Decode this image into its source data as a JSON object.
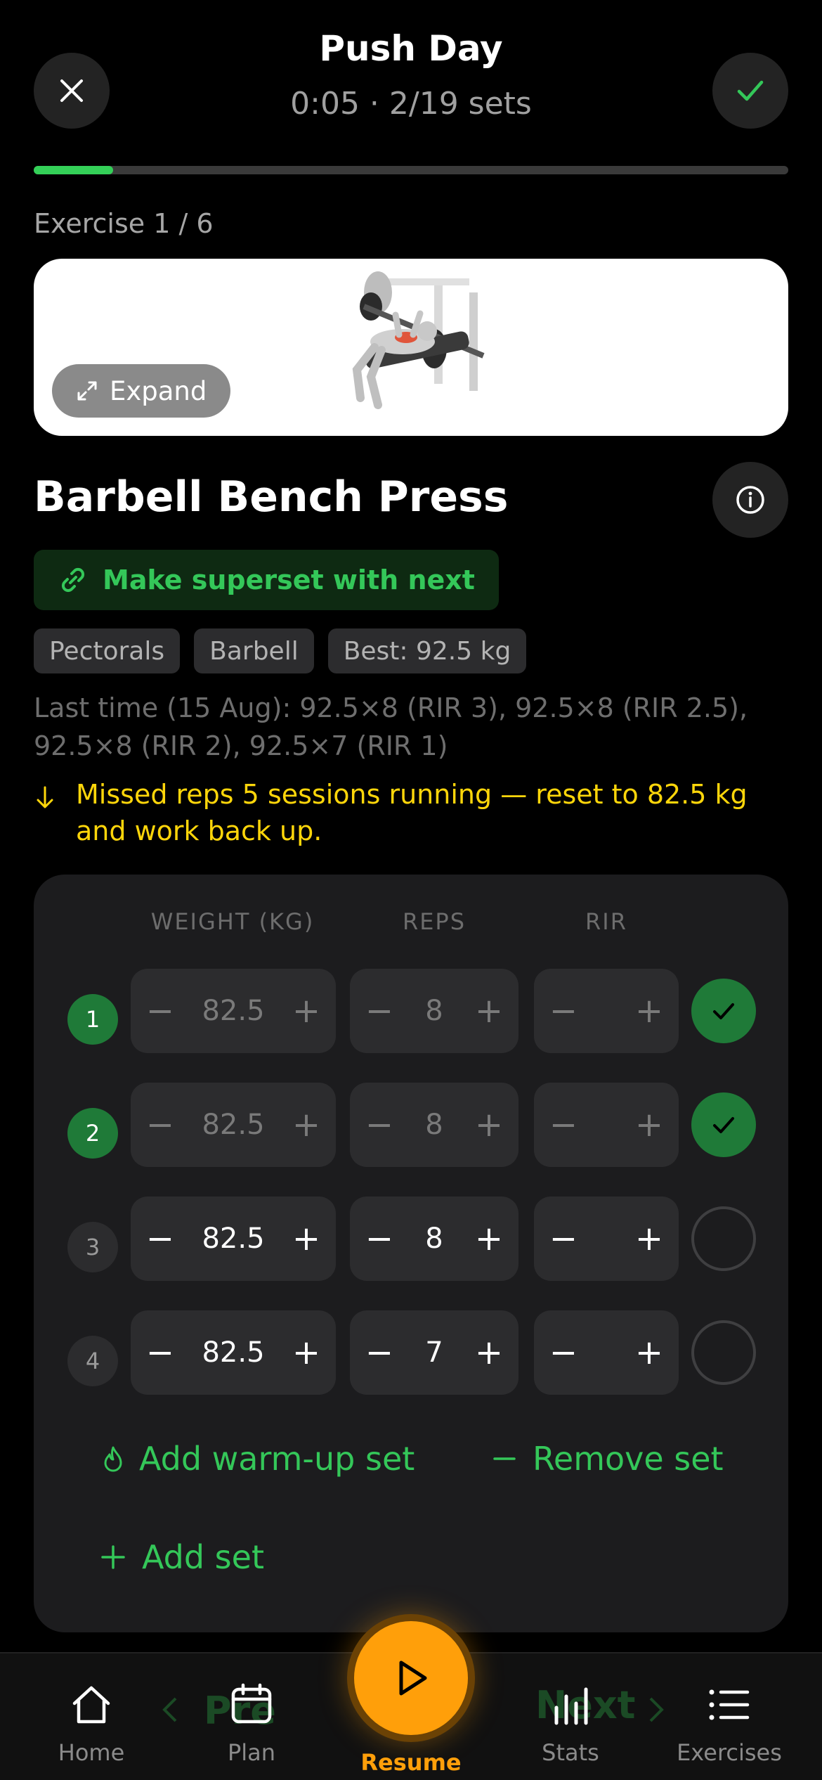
{
  "header": {
    "title": "Push Day",
    "subtitle": "0:05 · 2/19 sets",
    "progress_fraction": 0.1053
  },
  "exercise": {
    "counter": "Exercise 1 / 6",
    "expand_label": "Expand",
    "name": "Barbell Bench Press",
    "superset_label": "Make superset with next",
    "tags": [
      "Pectorals",
      "Barbell",
      "Best: 92.5 kg"
    ],
    "last_time": "Last time (15 Aug): 92.5×8 (RIR 3), 92.5×8 (RIR 2.5), 92.5×8 (RIR 2), 92.5×7 (RIR 1)",
    "warning": "Missed reps 5 sessions running — reset to 82.5 kg and work back up."
  },
  "sets_table": {
    "headers": {
      "weight": "WEIGHT (KG)",
      "reps": "REPS",
      "rir": "RIR"
    },
    "minus": "−",
    "plus": "+",
    "rows": [
      {
        "num": "1",
        "weight": "82.5",
        "reps": "8",
        "rir": "",
        "done": true
      },
      {
        "num": "2",
        "weight": "82.5",
        "reps": "8",
        "rir": "",
        "done": true
      },
      {
        "num": "3",
        "weight": "82.5",
        "reps": "8",
        "rir": "",
        "done": false
      },
      {
        "num": "4",
        "weight": "82.5",
        "reps": "7",
        "rir": "",
        "done": false
      }
    ],
    "add_warmup": "Add warm-up set",
    "remove_set": "Remove set",
    "add_set": "Add set"
  },
  "ghost_nav": {
    "prev": "Pre",
    "next": "Next"
  },
  "tabbar": {
    "home": "Home",
    "plan": "Plan",
    "resume": "Resume",
    "stats": "Stats",
    "exercises": "Exercises"
  },
  "colors": {
    "accent_green": "#34c759",
    "accent_orange": "#ff9f0a",
    "warning_yellow": "#ffd60a",
    "done_green": "#1f7a38"
  }
}
